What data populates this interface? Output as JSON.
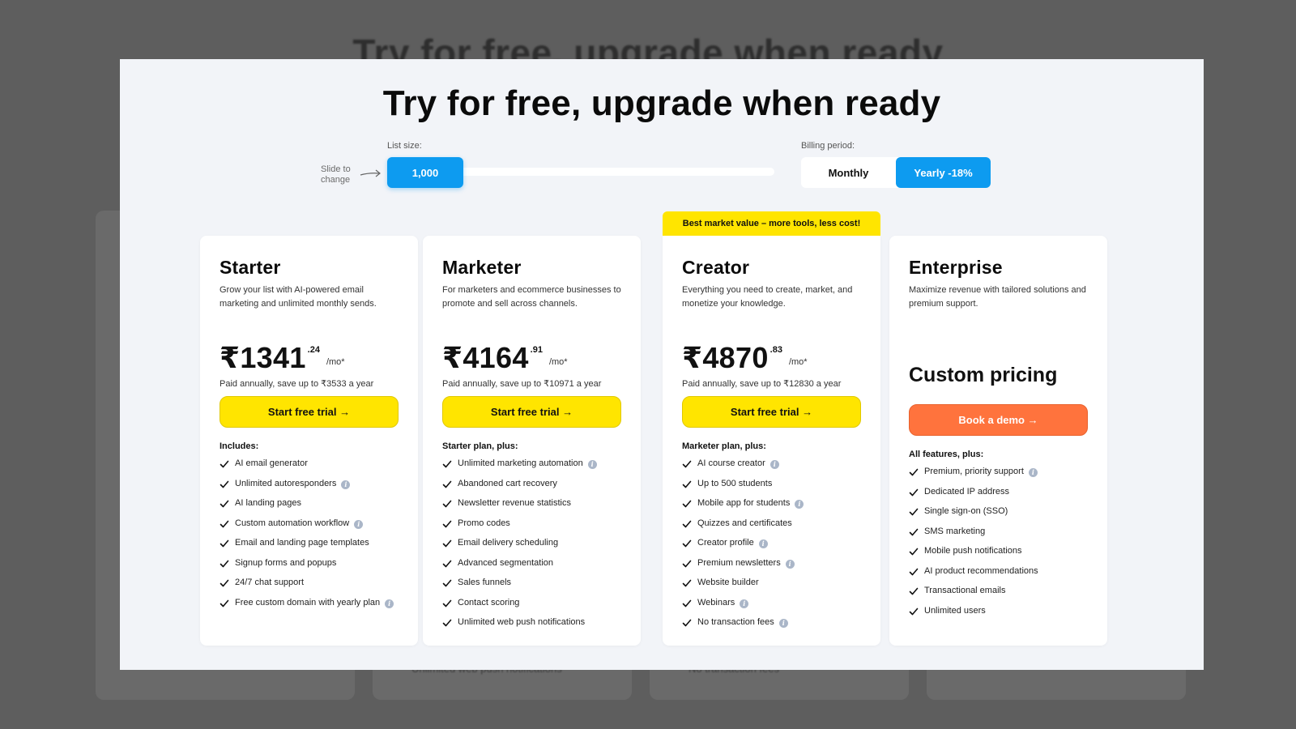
{
  "backdrop": {
    "title": "Try for free, upgrade when ready",
    "line_left": "Unlimited web push notifications",
    "line_right": "No transaction fees"
  },
  "header": {
    "title": "Try for free, upgrade when ready",
    "slide_hint_line1": "Slide to",
    "slide_hint_line2": "change",
    "list_size_label": "List size:",
    "list_size_value": "1,000",
    "billing_label": "Billing period:",
    "billing_monthly": "Monthly",
    "billing_yearly": "Yearly -18%"
  },
  "colors": {
    "accent_blue": "#0d9bf0",
    "cta_yellow": "#ffe500",
    "cta_orange": "#ff733d"
  },
  "plans": [
    {
      "name": "Starter",
      "desc": "Grow your list with AI-powered email marketing and unlimited monthly sends.",
      "price": "₹1341",
      "cents": ".24",
      "unit": "/mo*",
      "note": "Paid annually, save up to ₹3533 a year",
      "cta": "Start free trial →",
      "features_title": "Includes:",
      "features": [
        {
          "text": "AI email generator",
          "info": false
        },
        {
          "text": "Unlimited autoresponders",
          "info": true
        },
        {
          "text": "AI landing pages",
          "info": false
        },
        {
          "text": "Custom automation workflow",
          "info": true
        },
        {
          "text": "Email and landing page templates",
          "info": false
        },
        {
          "text": "Signup forms and popups",
          "info": false
        },
        {
          "text": "24/7 chat support",
          "info": false
        },
        {
          "text": "Free custom domain with yearly plan",
          "info": true
        }
      ]
    },
    {
      "name": "Marketer",
      "desc": "For marketers and ecommerce businesses to promote and sell across channels.",
      "price": "₹4164",
      "cents": ".91",
      "unit": "/mo*",
      "note": "Paid annually, save up to ₹10971 a year",
      "cta": "Start free trial →",
      "features_title": "Starter plan, plus:",
      "features": [
        {
          "text": "Unlimited marketing automation",
          "info": true
        },
        {
          "text": "Abandoned cart recovery",
          "info": false
        },
        {
          "text": "Newsletter revenue statistics",
          "info": false
        },
        {
          "text": "Promo codes",
          "info": false
        },
        {
          "text": "Email delivery scheduling",
          "info": false
        },
        {
          "text": "Advanced segmentation",
          "info": false
        },
        {
          "text": "Sales funnels",
          "info": false
        },
        {
          "text": "Contact scoring",
          "info": false
        },
        {
          "text": "Unlimited web push notifications",
          "info": false
        }
      ]
    },
    {
      "name": "Creator",
      "ribbon": "Best market value – more tools, less cost!",
      "desc": "Everything you need to create, market, and monetize your knowledge.",
      "price": "₹4870",
      "cents": ".83",
      "unit": "/mo*",
      "note": "Paid annually, save up to ₹12830 a year",
      "cta": "Start free trial →",
      "features_title": "Marketer plan, plus:",
      "features": [
        {
          "text": "AI course creator",
          "info": true
        },
        {
          "text": "Up to 500 students",
          "info": false
        },
        {
          "text": "Mobile app for students",
          "info": true
        },
        {
          "text": "Quizzes and certificates",
          "info": false
        },
        {
          "text": "Creator profile",
          "info": true
        },
        {
          "text": "Premium newsletters",
          "info": true
        },
        {
          "text": "Website builder",
          "info": false
        },
        {
          "text": "Webinars",
          "info": true
        },
        {
          "text": "No transaction fees",
          "info": true
        }
      ]
    },
    {
      "name": "Enterprise",
      "desc": "Maximize revenue with tailored solutions and premium support.",
      "custom_price": "Custom pricing",
      "cta": "Book a demo →",
      "features_title": "All features, plus:",
      "features": [
        {
          "text": "Premium, priority support",
          "info": true
        },
        {
          "text": "Dedicated IP address",
          "info": false
        },
        {
          "text": "Single sign-on (SSO)",
          "info": false
        },
        {
          "text": "SMS marketing",
          "info": false
        },
        {
          "text": "Mobile push notifications",
          "info": false
        },
        {
          "text": "AI product recommendations",
          "info": false
        },
        {
          "text": "Transactional emails",
          "info": false
        },
        {
          "text": "Unlimited users",
          "info": false
        }
      ]
    }
  ]
}
